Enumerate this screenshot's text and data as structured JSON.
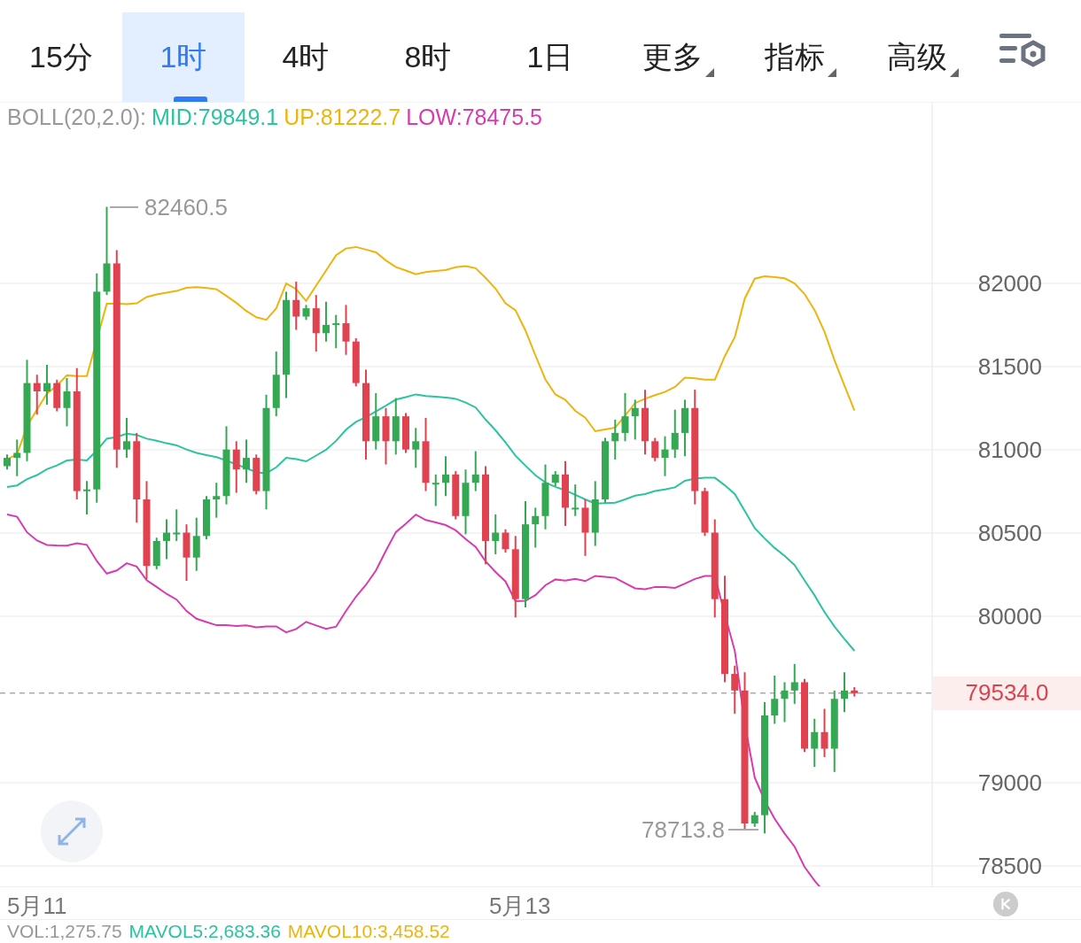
{
  "tabs": [
    {
      "label": "15分",
      "kind": "interval",
      "selected": false
    },
    {
      "label": "1时",
      "kind": "interval",
      "selected": true
    },
    {
      "label": "4时",
      "kind": "interval",
      "selected": false
    },
    {
      "label": "8时",
      "kind": "interval",
      "selected": false
    },
    {
      "label": "1日",
      "kind": "interval",
      "selected": false
    },
    {
      "label": "更多",
      "kind": "menu",
      "selected": false
    },
    {
      "label": "指标",
      "kind": "menu",
      "selected": false
    },
    {
      "label": "高级",
      "kind": "menu",
      "selected": false
    }
  ],
  "indicator": {
    "name": "BOLL(20,2.0):",
    "mid": "MID:79849.1",
    "up": "UP:81222.7",
    "low": "LOW:78475.5"
  },
  "y_axis": [
    "82000",
    "81500",
    "81000",
    "80500",
    "80000",
    "79000",
    "78500"
  ],
  "current_price": "79534.0",
  "high_label": "82460.5",
  "low_label": "78713.8",
  "x_axis": [
    "5月11",
    "5月13"
  ],
  "volume": {
    "vol": "VOL:1,275.75",
    "mavol5": "MAVOL5:2,683.36",
    "mavol10": "MAVOL10:3,458.52"
  }
}
